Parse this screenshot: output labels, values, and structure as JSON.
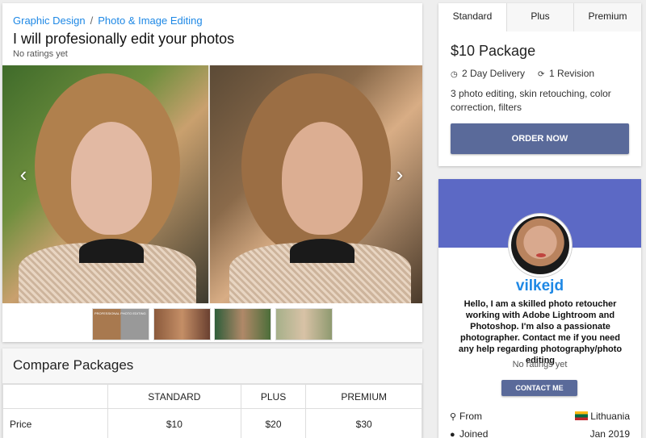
{
  "breadcrumb": {
    "items": [
      "Graphic Design",
      "Photo & Image Editing"
    ],
    "separator": "/"
  },
  "gig": {
    "title": "I will profesionally edit your photos",
    "rating_text": "No ratings yet",
    "slider": {
      "prev_icon": "chevron-left-icon",
      "next_icon": "chevron-right-icon"
    },
    "thumbnails": [
      {
        "label": "PROFESSIONAL PHOTO EDITING"
      },
      {
        "label": ""
      },
      {
        "label": ""
      },
      {
        "label": ""
      }
    ]
  },
  "compare": {
    "title": "Compare Packages",
    "columns": [
      "",
      "STANDARD",
      "PLUS",
      "PREMIUM"
    ],
    "rows": [
      {
        "label": "Price",
        "values": [
          "$10",
          "$20",
          "$30"
        ]
      }
    ]
  },
  "package": {
    "tabs": [
      "Standard",
      "Plus",
      "Premium"
    ],
    "active_tab": "Standard",
    "name": "$10 Package",
    "delivery": "2 Day Delivery",
    "revisions": "1 Revision",
    "delivery_icon": "clock-icon",
    "revision_icon": "refresh-icon",
    "description": "3 photo editing, skin retouching, color correction, filters",
    "order_label": "ORDER NOW"
  },
  "seller": {
    "name": "vilkejd",
    "bio": "Hello, I am a skilled photo retoucher working with Adobe Lightroom and Photoshop. I'm also a passionate photographer. Contact me if you need any help regarding photography/photo editing",
    "rating_text": "No ratings yet",
    "contact_label": "CONTACT ME",
    "from_label": "From",
    "from_value": "Lithuania",
    "joined_label": "Joined",
    "joined_value": "Jan 2019",
    "from_icon": "map-pin-icon",
    "joined_icon": "user-icon"
  },
  "colors": {
    "link": "#1e88e5",
    "button": "#5a6a9a",
    "banner": "#5c69c5"
  }
}
